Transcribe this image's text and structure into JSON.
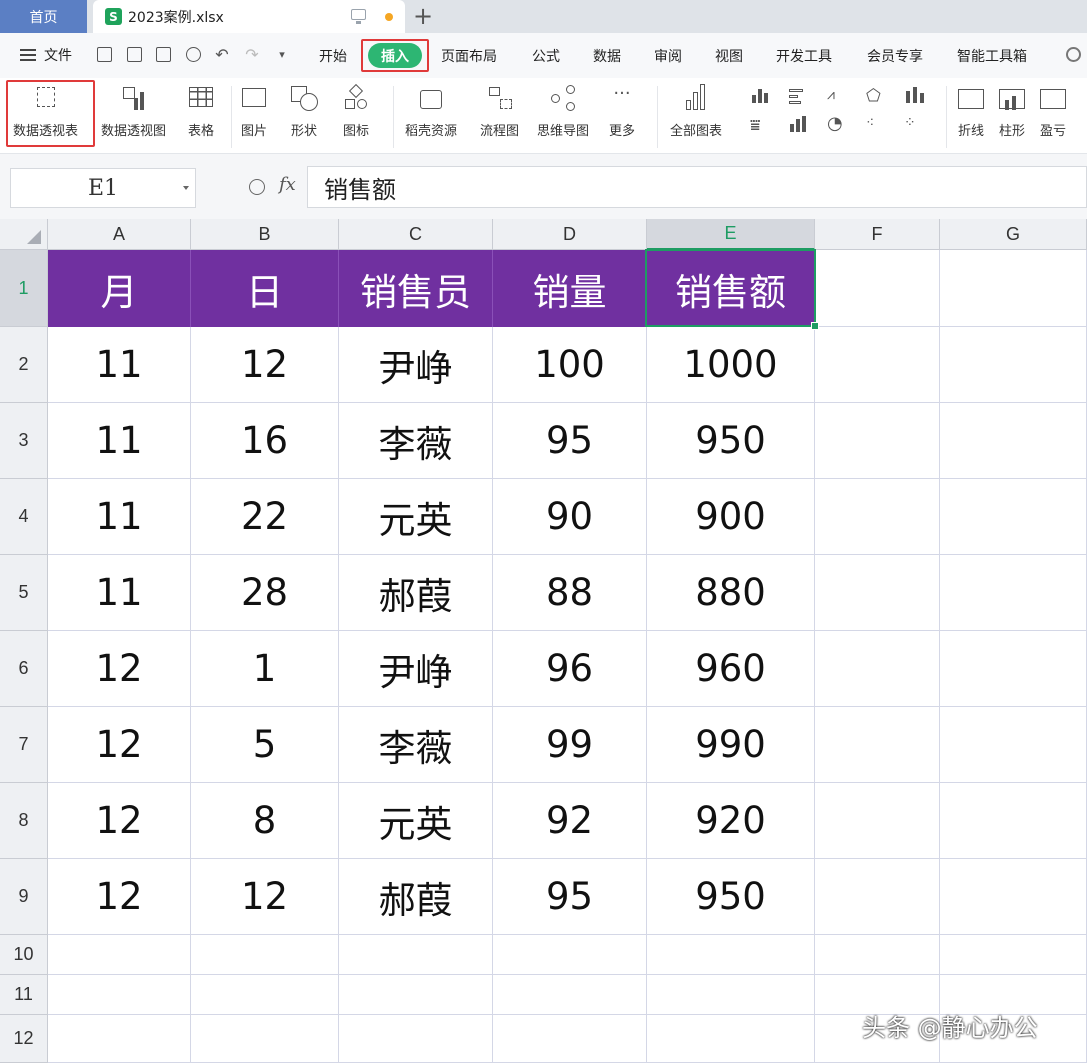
{
  "tabs": {
    "home": "首页",
    "file_icon": "S",
    "file_name": "2023案例.xlsx",
    "new_tab": "+"
  },
  "menu": {
    "file": "文件",
    "items": [
      "开始",
      "插入",
      "页面布局",
      "公式",
      "数据",
      "审阅",
      "视图",
      "开发工具",
      "会员专享",
      "智能工具箱"
    ],
    "active": "插入"
  },
  "ribbon": {
    "pivot_table": "数据透视表",
    "pivot_chart": "数据透视图",
    "table": "表格",
    "picture": "图片",
    "shape": "形状",
    "icons": "图标",
    "docer_resources": "稻壳资源",
    "flowchart": "流程图",
    "mindmap": "思维导图",
    "more": "更多",
    "all_charts": "全部图表",
    "sparkline_line": "折线",
    "sparkline_column": "柱形",
    "sparkline_winloss": "盈亏"
  },
  "formula_bar": {
    "name_box": "E1",
    "fx": "fx",
    "formula": "销售额"
  },
  "sheet": {
    "columns": [
      "A",
      "B",
      "C",
      "D",
      "E",
      "F",
      "G"
    ],
    "rows": [
      "1",
      "2",
      "3",
      "4",
      "5",
      "6",
      "7",
      "8",
      "9",
      "10",
      "11",
      "12"
    ],
    "active_cell": "E1",
    "header": [
      "月",
      "日",
      "销售员",
      "销量",
      "销售额"
    ],
    "data": [
      [
        "11",
        "12",
        "尹峥",
        "100",
        "1000"
      ],
      [
        "11",
        "16",
        "李薇",
        "95",
        "950"
      ],
      [
        "11",
        "22",
        "元英",
        "90",
        "900"
      ],
      [
        "11",
        "28",
        "郝葭",
        "88",
        "880"
      ],
      [
        "12",
        "1",
        "尹峥",
        "96",
        "960"
      ],
      [
        "12",
        "5",
        "李薇",
        "99",
        "990"
      ],
      [
        "12",
        "8",
        "元英",
        "92",
        "920"
      ],
      [
        "12",
        "12",
        "郝葭",
        "95",
        "950"
      ]
    ],
    "header_fill": "#7030a0",
    "selection_color": "#1e9c63"
  },
  "watermark": "头条 @静心办公"
}
